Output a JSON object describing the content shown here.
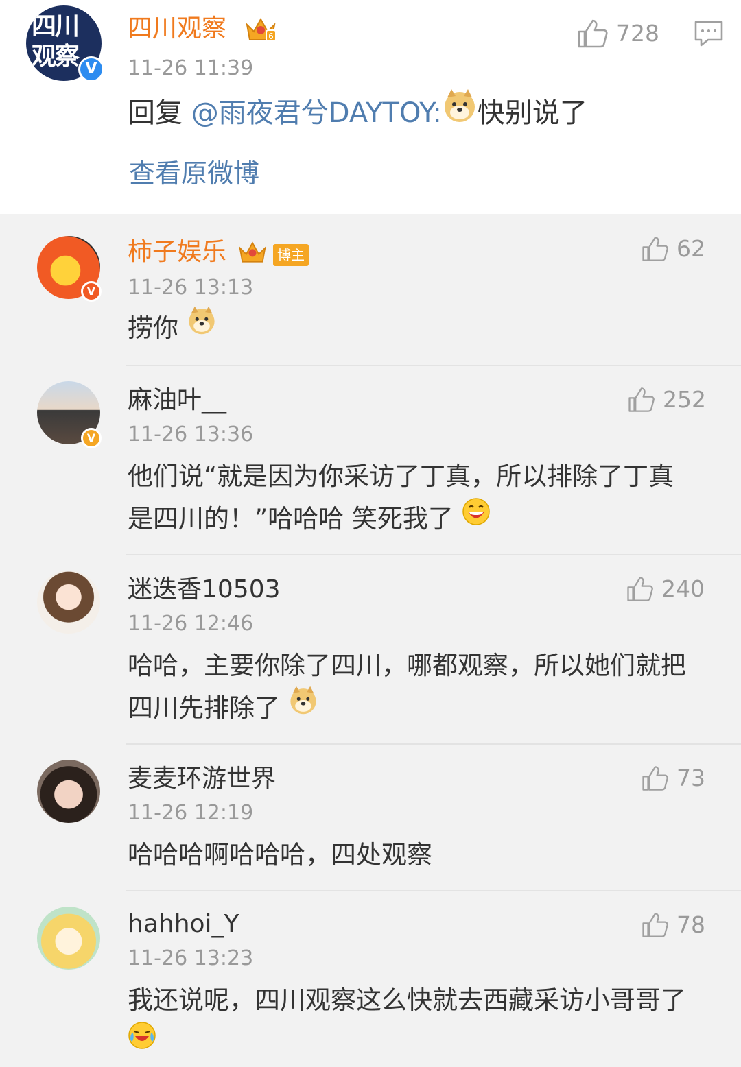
{
  "main_comment": {
    "username": "四川观察",
    "time": "11-26 11:39",
    "likes": "728",
    "reply_prefix": "回复",
    "mention": "@雨夜君兮DAYTOY",
    "colon": ":",
    "text": "快别说了",
    "view_original": "查看原微博",
    "avatar_text_1": "四川",
    "avatar_text_2": "观察",
    "level": "6"
  },
  "replies": [
    {
      "username": "柿子娱乐",
      "badge": "博主",
      "time": "11-26 13:13",
      "likes": "62",
      "text": "捞你"
    },
    {
      "username": "麻油叶__",
      "time": "11-26 13:36",
      "likes": "252",
      "text": "他们说“就是因为你采访了丁真，所以排除了丁真是四川的！”哈哈哈 笑死我了"
    },
    {
      "username": "迷迭香10503",
      "time": "11-26 12:46",
      "likes": "240",
      "text": "哈哈，主要你除了四川，哪都观察，所以她们就把四川先排除了"
    },
    {
      "username": "麦麦环游世界",
      "time": "11-26 12:19",
      "likes": "73",
      "text": "哈哈哈啊哈哈哈，四处观察"
    },
    {
      "username": "hahhoi_Y",
      "time": "11-26 13:23",
      "likes": "78",
      "text": "我还说呢，四川观察这么快就去西藏采访小哥哥了"
    }
  ],
  "icons": {
    "like": "thumbs-up-icon",
    "comment": "comment-icon",
    "verified": "verified-icon",
    "crown": "crown-icon",
    "doge": "doge-emoji",
    "laugh": "laugh-emoji",
    "cry_laugh": "cry-laugh-emoji"
  },
  "colors": {
    "vip_name": "#f07a1e",
    "link": "#507daf",
    "meta": "#999999",
    "verified_blue": "#2d8cf0",
    "verified_orange": "#f5a623"
  }
}
